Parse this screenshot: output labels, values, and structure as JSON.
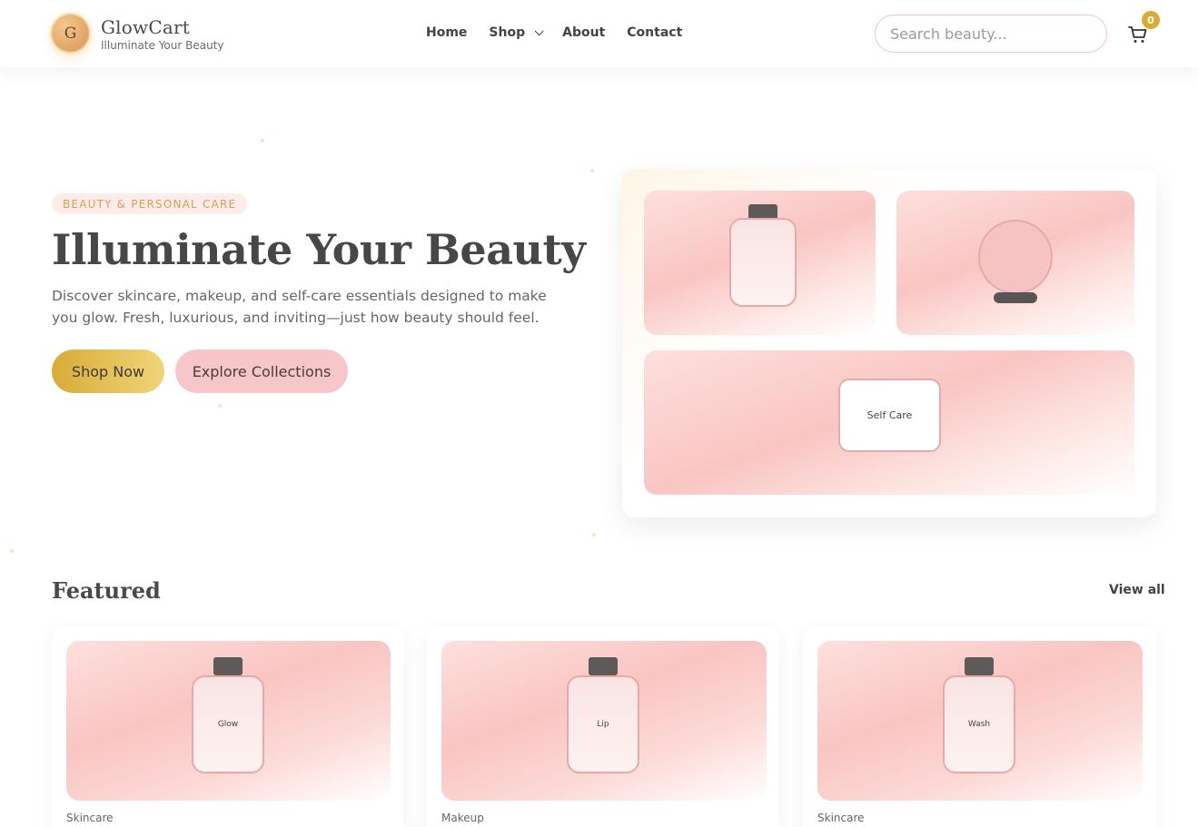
{
  "brand": {
    "initial": "G",
    "name": "GlowCart",
    "tagline": "Illuminate Your Beauty"
  },
  "nav": {
    "items": [
      {
        "label": "Home"
      },
      {
        "label": "Shop"
      },
      {
        "label": "About"
      },
      {
        "label": "Contact"
      }
    ]
  },
  "search": {
    "placeholder": "Search beauty..."
  },
  "cart": {
    "count": "0"
  },
  "hero": {
    "eyebrow": "BEAUTY & PERSONAL CARE",
    "title": "Illuminate Your Beauty",
    "description": "Discover skincare, makeup, and self-care essentials designed to make you glow. Fresh, luxurious, and inviting—just how beauty should feel.",
    "primary_cta": "Shop Now",
    "secondary_cta": "Explore Collections",
    "showcase_label": "Self Care"
  },
  "featured": {
    "title": "Featured",
    "view_all": "View all",
    "products": [
      {
        "label": "Glow",
        "category": "Skincare"
      },
      {
        "label": "Lip",
        "category": "Makeup"
      },
      {
        "label": "Wash",
        "category": "Skincare"
      }
    ]
  },
  "colors": {
    "accent_gold": "#d9ad32",
    "accent_pink": "#f7c6c9",
    "text": "#4a4a4a"
  }
}
